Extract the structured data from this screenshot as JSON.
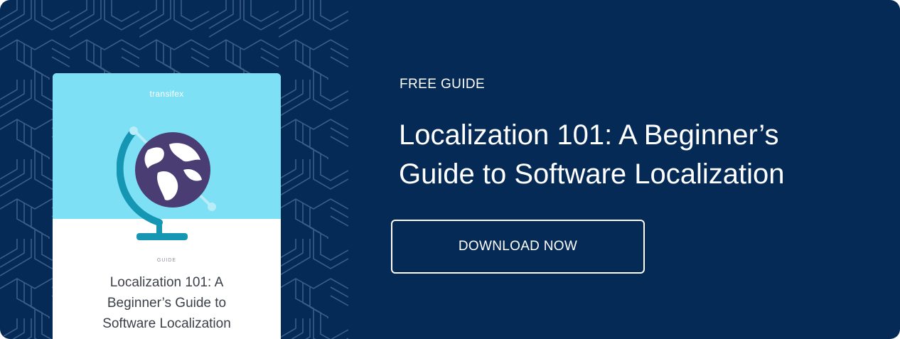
{
  "book": {
    "brand": "transifex",
    "label": "GUIDE",
    "title_line1": "Localization 101: A",
    "title_line2": "Beginner’s Guide to",
    "title_line3": "Software Localization"
  },
  "promo": {
    "eyebrow": "FREE GUIDE",
    "headline_line1": "Localization 101: A Beginner’s",
    "headline_line2": "Guide to Software Localization",
    "cta_label": "DOWNLOAD NOW"
  },
  "colors": {
    "background": "#042a55",
    "pattern_line": "#3a5c86",
    "cover": "#5fd0ec",
    "globe": "#4a3d73",
    "stand": "#1596b3"
  },
  "icons": {
    "pattern": "geometric-hexagon-pattern",
    "cover_art": "globe-icon"
  }
}
